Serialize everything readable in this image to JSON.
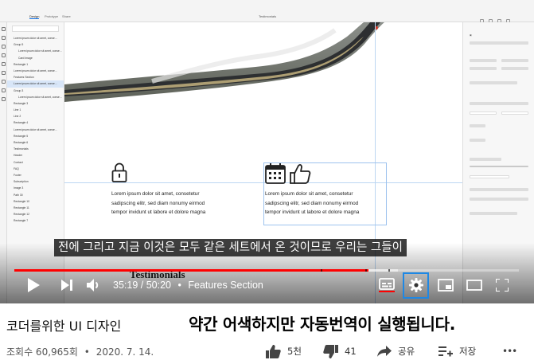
{
  "editor": {
    "tabs": [
      "Design",
      "Prototype",
      "Share"
    ],
    "document": "Testimonials",
    "layers": [
      "Lorem ipsum dolor sit amet, conse...",
      "Group 5",
      "Lorem ipsum dolor sit amet, conse...",
      "Card Image",
      "Rectangle 1",
      "Lorem ipsum dolor sit amet, conse...",
      "Features Section",
      "Lorem ipsum dolor sit amet, conse...",
      "Group 3",
      "Lorem ipsum dolor sit amet, conse...",
      "Rectangle 3",
      "Line 1",
      "Line 2",
      "Rectangle 4",
      "Lorem ipsum dolor sit amet, conse...",
      "Rectangle 5",
      "Rectangle 6",
      "Testimonials",
      "Header",
      "Contact",
      "FAQ",
      "Footer",
      "Subscription",
      "Image 3",
      "Path 30",
      "Rectangle 10",
      "Rectangle 11",
      "Rectangle 12",
      "Rectangle 7"
    ]
  },
  "canvas": {
    "features": [
      {
        "icon": "lock-icon",
        "lines": [
          "Lorem ipsum dolor sit amet, consetetur",
          "sadipscing elitr, sed diam nonumy eirmod",
          "tempor invidunt ut labore et dolore magna"
        ]
      },
      {
        "icon": "calendar-thumbs-up-icon",
        "lines": [
          "Lorem ipsum dolor sit amet, consetetur",
          "sadipscing elitr, sed diam nonumy eirmod",
          "tempor invidunt ut labore et dolore magna"
        ]
      }
    ],
    "testimonials_heading": "Testimonials"
  },
  "player": {
    "subtitle": "전에 그리고 지금 이것은 모두 같은 세트에서 온 것이므로 우리는 그들이",
    "current_time": "35:19",
    "duration": "50:20",
    "chapter_separator": "•",
    "chapter": "Features Section",
    "progress": 0.702,
    "buffered": 0.76,
    "accent_color": "#ff0000"
  },
  "video": {
    "title": "코더를위한 UI 디자인",
    "promo_text": "약간 어색하지만 자동번역이 실행됩니다.",
    "views": "조회수 60,965회",
    "meta_separator": "•",
    "date": "2020. 7. 14.",
    "likes": "5천",
    "dislikes": "41",
    "share_label": "공유",
    "save_label": "저장",
    "more_label": "•••"
  }
}
